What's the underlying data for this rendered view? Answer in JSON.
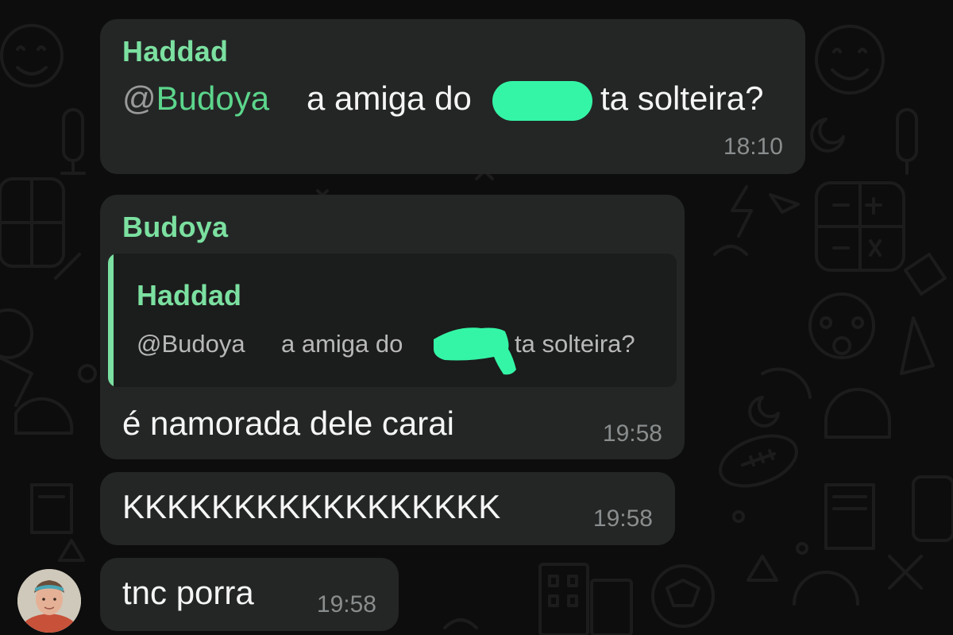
{
  "colors": {
    "background": "#0d0d0d",
    "bubble": "#242626",
    "sender_name": "#7be0a0",
    "mention": "#5cd68c",
    "redaction": "#34f5a6",
    "timestamp": "#8a8d8d"
  },
  "messages": [
    {
      "sender": "Haddad",
      "mention_at": "@",
      "mention_name": "Budoya",
      "text_before_redaction": "a amiga do",
      "text_after_redaction": "ta solteira?",
      "time": "18:10"
    },
    {
      "sender": "Budoya",
      "quote": {
        "sender": "Haddad",
        "mention": "@Budoya",
        "text_before_redaction": "a amiga do",
        "text_after_redaction": "ta solteira?"
      },
      "text": "é namorada dele carai",
      "time": "19:58"
    },
    {
      "text": "KKKKKKKKKKKKKKKKK",
      "time": "19:58"
    },
    {
      "text": "tnc porra",
      "time": "19:58"
    }
  ],
  "avatar": {
    "icon": "user-avatar-photo"
  },
  "wallpaper": {
    "icon": "doodle-pattern"
  }
}
